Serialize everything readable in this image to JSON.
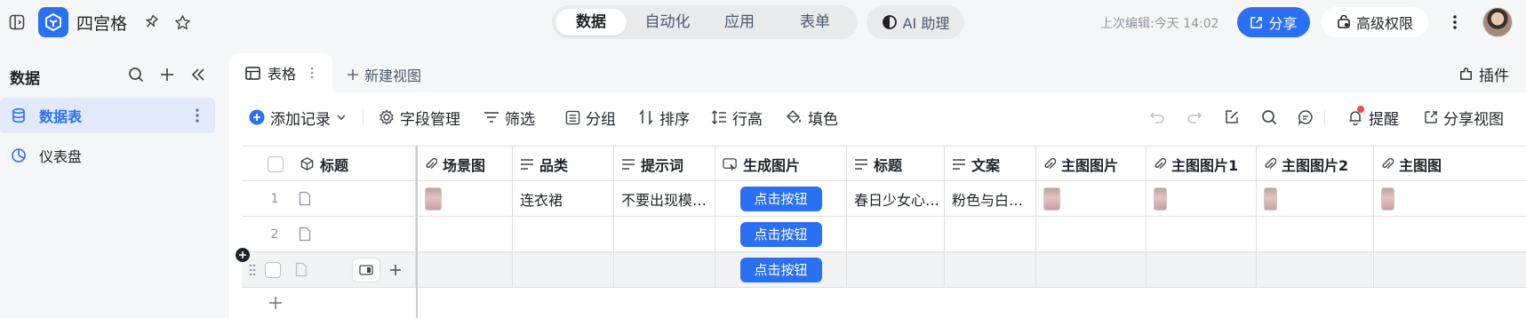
{
  "topbar": {
    "app_title": "四宫格",
    "segments": [
      "数据",
      "自动化",
      "应用",
      "表单"
    ],
    "active_segment": "数据",
    "ai_label": "AI 助理",
    "last_edit": "上次编辑:今天 14:02",
    "share_label": "分享",
    "permission_label": "高级权限",
    "brand_color": "#2b70f0"
  },
  "sidebar": {
    "title": "数据",
    "items": [
      {
        "label": "数据表",
        "icon": "database-icon",
        "active": true
      },
      {
        "label": "仪表盘",
        "icon": "dashboard-icon",
        "active": false
      }
    ]
  },
  "tabs": {
    "active_tab": "表格",
    "new_view": "新建视图",
    "plugin": "插件"
  },
  "toolbar": {
    "add_record": "添加记录",
    "field_manage": "字段管理",
    "filter": "筛选",
    "group": "分组",
    "sort": "排序",
    "row_height": "行高",
    "fill_color": "填色",
    "remind": "提醒",
    "share_view": "分享视图"
  },
  "table": {
    "columns": [
      "标题",
      "场景图",
      "品类",
      "提示词",
      "生成图片",
      "标题",
      "文案",
      "主图图片",
      "主图图片1",
      "主图图片2",
      "主图图"
    ],
    "rows": [
      {
        "num": "1",
        "category": "连衣裙",
        "prompt": "不要出现模…",
        "button": "点击按钮",
        "title": "春日少女心…",
        "copy": "粉色与白…",
        "has_images": true
      },
      {
        "num": "2",
        "category": "",
        "prompt": "",
        "button": "点击按钮",
        "title": "",
        "copy": "",
        "has_images": false
      },
      {
        "num": "",
        "category": "",
        "prompt": "",
        "button": "点击按钮",
        "title": "",
        "copy": "",
        "has_images": false
      }
    ]
  }
}
